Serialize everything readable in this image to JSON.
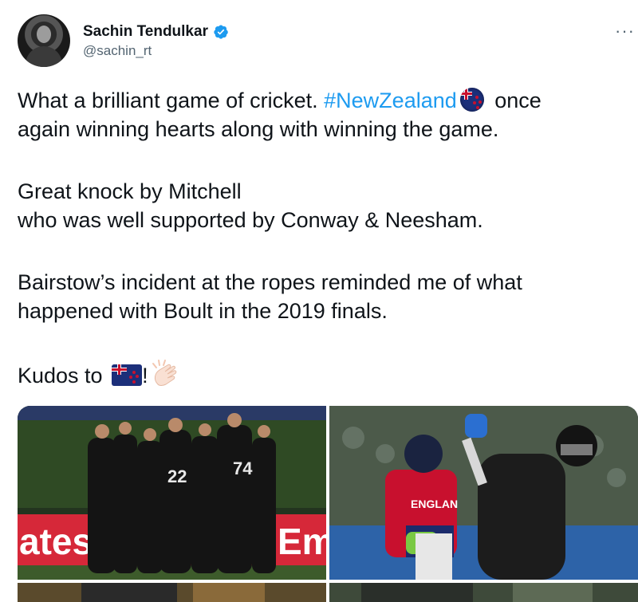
{
  "author": {
    "name": "Sachin Tendulkar",
    "handle": "@sachin_rt",
    "verified": true,
    "avatar_icon": "profile-photo"
  },
  "more_options_label": "···",
  "tweet": {
    "line1_pre": "What a brilliant game of cricket. ",
    "line1_hashtag": "#NewZealand",
    "line1_post": " once",
    "line2": "again winning hearts along with winning the game.",
    "line3": "Great knock by Mitchell",
    "line4": "who was well supported by Conway & Neesham.",
    "line5": "Bairstow’s incident at the ropes reminded me of what",
    "line6": "happened with Boult in the 2019 finals.",
    "line7_pre": "Kudos to ",
    "line7_post": "!",
    "emoji": [
      "new-zealand-flag-icon",
      "clapping-hands-icon"
    ]
  },
  "media": {
    "photo1_banner_text": "ates",
    "photo1_banner_text_right": "Em",
    "photo1_jersey_numbers": [
      "22",
      "74"
    ],
    "photo2_jersey_text": "ENGLAN"
  },
  "colors": {
    "hashtag": "#1d9bf0",
    "verified": "#1d9bf0",
    "secondary_text": "#536471",
    "banner_red": "#d62839"
  }
}
